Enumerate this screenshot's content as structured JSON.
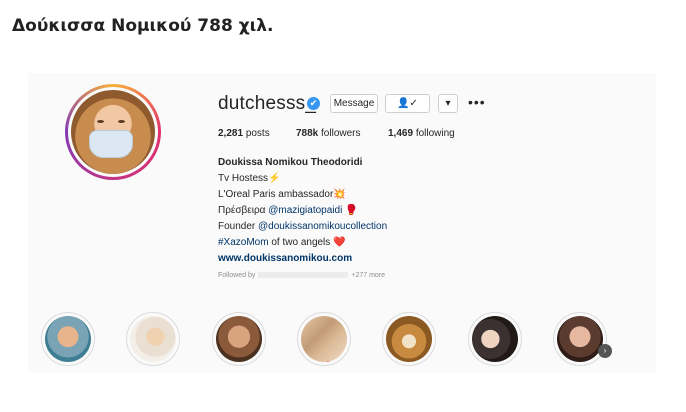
{
  "article": {
    "title": "Δούκισσα Νομικού 788 χιλ."
  },
  "profile": {
    "username": "dutchesss_",
    "verified_mark": "✔",
    "buttons": {
      "message": "Message",
      "follow": "👤✓",
      "dropdown": "▾",
      "more": "•••"
    },
    "stats": {
      "posts": {
        "count": "2,281",
        "label": "posts"
      },
      "followers": {
        "count": "788k",
        "label": "followers"
      },
      "following": {
        "count": "1,469",
        "label": "following"
      }
    },
    "bio": {
      "full_name": "Doukissa Nomikou Theodoridi",
      "line1": "Tv Hostess⚡",
      "line2": "L'Oreal Paris ambassador💥",
      "line3_prefix": "Πρέσβειρα ",
      "line3_link": "@mazigiatopaidi",
      "line3_suffix": " 🥊",
      "line4_prefix": "Founder ",
      "line4_link": "@doukissanomikoucollection",
      "line5_tag": "#XazoMom",
      "line5_suffix": " of two angels ❤️",
      "website": "www.doukissanomikou.com"
    },
    "followed_by": {
      "prefix": "Followed by",
      "suffix": "+277 more"
    }
  },
  "icons": {
    "avatar": "profile-photo",
    "next": "chevron-right-icon"
  }
}
